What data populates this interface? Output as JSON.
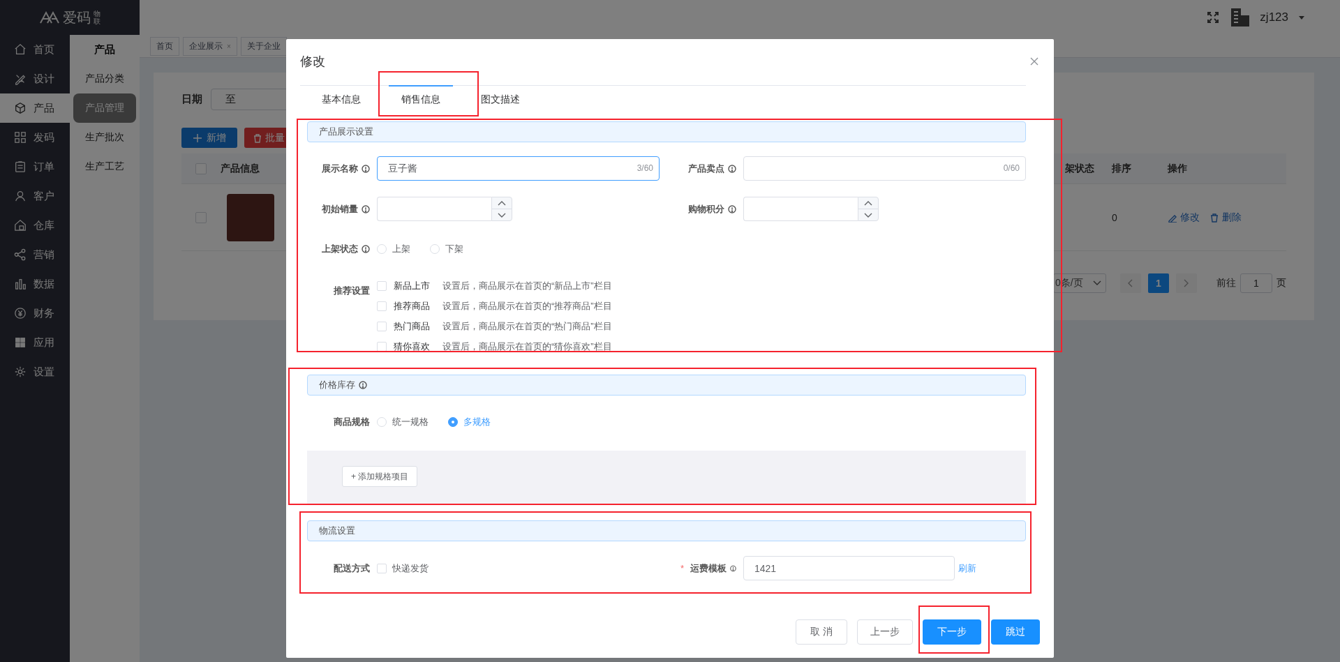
{
  "sidebar": {
    "logo_text": "爱码",
    "logo_subtext": "物联",
    "items": [
      {
        "label": "首页",
        "selected": false
      },
      {
        "label": "设计",
        "selected": false
      },
      {
        "label": "产品",
        "selected": true
      },
      {
        "label": "发码",
        "selected": false
      },
      {
        "label": "订单",
        "selected": false
      },
      {
        "label": "客户",
        "selected": false
      },
      {
        "label": "仓库",
        "selected": false
      },
      {
        "label": "营销",
        "selected": false
      },
      {
        "label": "数据",
        "selected": false
      },
      {
        "label": "财务",
        "selected": false
      },
      {
        "label": "应用",
        "selected": false
      },
      {
        "label": "设置",
        "selected": false
      }
    ]
  },
  "submenu": {
    "title": "产品",
    "items": [
      {
        "label": "产品分类",
        "selected": false
      },
      {
        "label": "产品管理",
        "selected": true
      },
      {
        "label": "生产批次",
        "selected": false
      },
      {
        "label": "生产工艺",
        "selected": false
      }
    ]
  },
  "header": {
    "user": "zj123"
  },
  "page_tabs": [
    {
      "label": "首页"
    },
    {
      "label": "企业展示",
      "close": "×"
    },
    {
      "label": "关于企业"
    }
  ],
  "filter": {
    "label": "日期",
    "range_separator": "至"
  },
  "actions": [
    {
      "label": "新增",
      "kind": "primary"
    },
    {
      "label": "批量",
      "kind": "danger"
    }
  ],
  "table": {
    "columns": [
      "产品信息",
      "架状态",
      "排序",
      "操作"
    ],
    "header_checked": false,
    "rows": [
      {
        "checked": false,
        "sort": "0",
        "actions": [
          "修改",
          "删除"
        ]
      }
    ]
  },
  "pagination": {
    "page_size": "0条/页",
    "pages": [
      {
        "label": "1",
        "selected": true
      }
    ],
    "goto_label": "前往",
    "goto_value": "1",
    "goto_suffix": "页"
  },
  "modal": {
    "title": "修改",
    "tabs": [
      {
        "label": "基本信息",
        "selected": false
      },
      {
        "label": "销售信息",
        "selected": true
      },
      {
        "label": "图文描述",
        "selected": false
      }
    ],
    "display_section": {
      "title": "产品展示设置",
      "display_name": {
        "label": "展示名称",
        "info": true,
        "value": "豆子酱",
        "counter": "3/60",
        "focused": true
      },
      "selling_point": {
        "label": "产品卖点",
        "info": true,
        "counter": "0/60",
        "focused": false
      },
      "initial_sales": {
        "label": "初始销量",
        "info": true
      },
      "points": {
        "label": "购物积分",
        "info": true
      },
      "shelf_status": {
        "label": "上架状态",
        "info": true,
        "options": [
          {
            "label": "上架",
            "selected": false
          },
          {
            "label": "下架",
            "selected": false
          }
        ]
      },
      "recommend": {
        "label": "推荐设置",
        "options": [
          {
            "label": "新品上市",
            "checked": false,
            "hint": "设置后，商品展示在首页的“新品上市”栏目"
          },
          {
            "label": "推荐商品",
            "checked": false,
            "hint": "设置后，商品展示在首页的“推荐商品”栏目"
          },
          {
            "label": "热门商品",
            "checked": false,
            "hint": "设置后，商品展示在首页的“热门商品”栏目"
          },
          {
            "label": "猜你喜欢",
            "checked": false,
            "hint": "设置后，商品展示在首页的“猜你喜欢”栏目"
          }
        ]
      }
    },
    "price_section": {
      "title": "价格库存",
      "info": true,
      "spec": {
        "label": "商品规格",
        "options": [
          {
            "label": "统一规格",
            "selected": false
          },
          {
            "label": "多规格",
            "selected": true
          }
        ]
      },
      "add_button": "+ 添加规格项目"
    },
    "logistics_section": {
      "title": "物流设置",
      "delivery": {
        "label": "配送方式",
        "options": [
          {
            "label": "快递发货",
            "checked": false
          }
        ]
      },
      "freight": {
        "required_mark": "*",
        "label": "运费模板",
        "info": true,
        "value": "1421",
        "refresh": "刷新"
      }
    },
    "footer": [
      {
        "label": "取 消",
        "kind": "default"
      },
      {
        "label": "上一步",
        "kind": "default"
      },
      {
        "label": "下一步",
        "kind": "primary"
      },
      {
        "label": "跳过",
        "kind": "primary"
      }
    ]
  }
}
